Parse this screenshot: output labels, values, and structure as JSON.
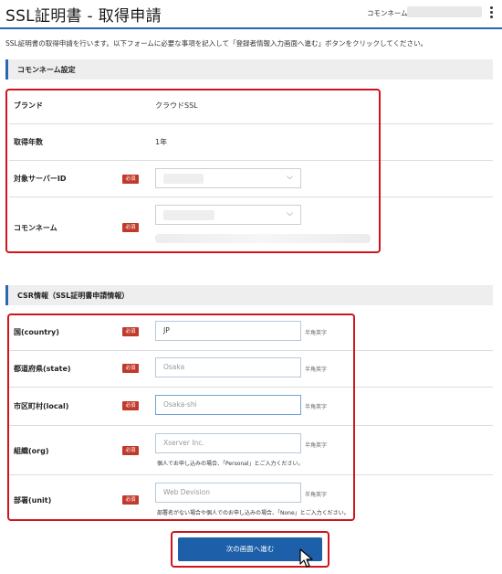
{
  "header": {
    "title": "SSL証明書 - 取得申請",
    "common_name_label": "コモンネーム"
  },
  "description": "SSL証明書の取得申請を行います。以下フォームに必要な事項を記入して「登録者情報入力画面へ進む」ボタンをクリックしてください。",
  "sections": {
    "common_name": {
      "heading": "コモンネーム設定",
      "brand_label": "ブランド",
      "brand_value": "クラウドSSL",
      "years_label": "取得年数",
      "years_value": "1年",
      "server_id_label": "対象サーバーID",
      "common_name_label": "コモンネーム",
      "required_badge": "必須"
    },
    "csr": {
      "heading": "CSR情報（SSL証明書申請情報）",
      "required_badge": "必須",
      "alnum_hint": "半角英字",
      "fields": [
        {
          "label": "国(country)",
          "value": "JP",
          "placeholder": ""
        },
        {
          "label": "都道府県(state)",
          "value": "",
          "placeholder": "Osaka"
        },
        {
          "label": "市区町村(local)",
          "value": "",
          "placeholder": "Osaka-shi"
        },
        {
          "label": "組織(org)",
          "value": "",
          "placeholder": "Xserver Inc.",
          "note": "個人でお申し込みの場合、「Personal」とご入力ください。"
        },
        {
          "label": "部署(unit)",
          "value": "",
          "placeholder": "Web Devision",
          "note": "部署名がない場合や個人でのお申し込みの場合、「None」とご入力ください。"
        }
      ]
    }
  },
  "submit": {
    "label": "次の画面へ進む"
  },
  "colors": {
    "accent": "#2a66b2",
    "highlight": "#d0141c",
    "badge": "#c0392b",
    "button": "#1d5fa8"
  }
}
